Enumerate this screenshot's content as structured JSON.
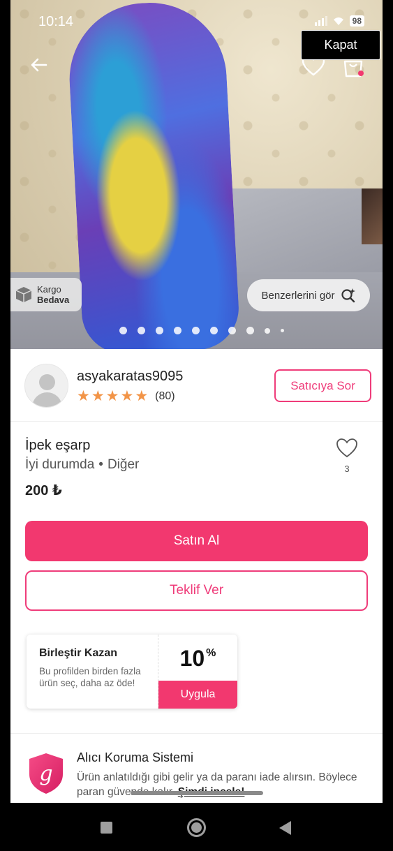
{
  "status_bar": {
    "time": "10:14",
    "battery": "98"
  },
  "overlay": {
    "close_label": "Kapat"
  },
  "hero": {
    "shipping_line1": "Kargo",
    "shipping_line2": "Bedava",
    "similar_label": "Benzerlerini gör",
    "image_count": 10,
    "active_image": 1
  },
  "seller": {
    "username": "asyakaratas9095",
    "rating_stars": 5,
    "rating_count": "(80)",
    "ask_button": "Satıcıya Sor"
  },
  "product": {
    "title": "İpek eşarp",
    "condition": "İyi durumda",
    "separator": "•",
    "category": "Diğer",
    "price": "200 ₺",
    "favorite_count": "3"
  },
  "actions": {
    "buy_label": "Satın Al",
    "offer_label": "Teklif Ver"
  },
  "bundle": {
    "title": "Birleştir Kazan",
    "description": "Bu profilden birden fazla ürün seç, daha az öde!",
    "discount_value": "10",
    "discount_unit": "%",
    "apply_label": "Uygula"
  },
  "protection": {
    "title": "Alıcı Koruma Sistemi",
    "description": "Ürün anlatıldığı gibi gelir ya da paranı iade alırsın. Böylece paran güvende kalır.",
    "link": "Şimdi incele!",
    "logo_letter": "g"
  },
  "colors": {
    "brand": "#f2386f",
    "star": "#f29447"
  },
  "icons": [
    "back-arrow-icon",
    "heart-icon",
    "shopping-bag-icon",
    "box-icon",
    "search-sparkle-icon",
    "star-icon",
    "shield-icon"
  ]
}
